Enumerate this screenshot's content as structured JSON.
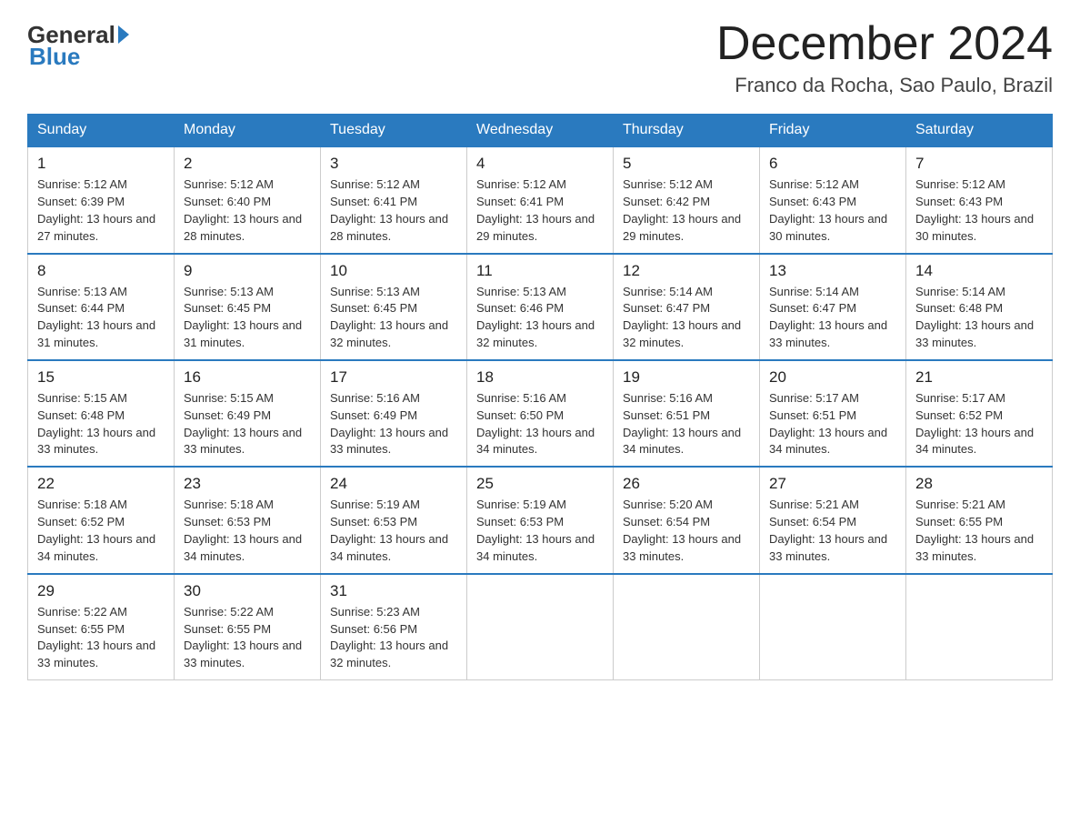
{
  "header": {
    "logo_general": "General",
    "logo_blue": "Blue",
    "title": "December 2024",
    "subtitle": "Franco da Rocha, Sao Paulo, Brazil"
  },
  "days_of_week": [
    "Sunday",
    "Monday",
    "Tuesday",
    "Wednesday",
    "Thursday",
    "Friday",
    "Saturday"
  ],
  "weeks": [
    [
      {
        "day": "1",
        "sunrise": "5:12 AM",
        "sunset": "6:39 PM",
        "daylight": "13 hours and 27 minutes."
      },
      {
        "day": "2",
        "sunrise": "5:12 AM",
        "sunset": "6:40 PM",
        "daylight": "13 hours and 28 minutes."
      },
      {
        "day": "3",
        "sunrise": "5:12 AM",
        "sunset": "6:41 PM",
        "daylight": "13 hours and 28 minutes."
      },
      {
        "day": "4",
        "sunrise": "5:12 AM",
        "sunset": "6:41 PM",
        "daylight": "13 hours and 29 minutes."
      },
      {
        "day": "5",
        "sunrise": "5:12 AM",
        "sunset": "6:42 PM",
        "daylight": "13 hours and 29 minutes."
      },
      {
        "day": "6",
        "sunrise": "5:12 AM",
        "sunset": "6:43 PM",
        "daylight": "13 hours and 30 minutes."
      },
      {
        "day": "7",
        "sunrise": "5:12 AM",
        "sunset": "6:43 PM",
        "daylight": "13 hours and 30 minutes."
      }
    ],
    [
      {
        "day": "8",
        "sunrise": "5:13 AM",
        "sunset": "6:44 PM",
        "daylight": "13 hours and 31 minutes."
      },
      {
        "day": "9",
        "sunrise": "5:13 AM",
        "sunset": "6:45 PM",
        "daylight": "13 hours and 31 minutes."
      },
      {
        "day": "10",
        "sunrise": "5:13 AM",
        "sunset": "6:45 PM",
        "daylight": "13 hours and 32 minutes."
      },
      {
        "day": "11",
        "sunrise": "5:13 AM",
        "sunset": "6:46 PM",
        "daylight": "13 hours and 32 minutes."
      },
      {
        "day": "12",
        "sunrise": "5:14 AM",
        "sunset": "6:47 PM",
        "daylight": "13 hours and 32 minutes."
      },
      {
        "day": "13",
        "sunrise": "5:14 AM",
        "sunset": "6:47 PM",
        "daylight": "13 hours and 33 minutes."
      },
      {
        "day": "14",
        "sunrise": "5:14 AM",
        "sunset": "6:48 PM",
        "daylight": "13 hours and 33 minutes."
      }
    ],
    [
      {
        "day": "15",
        "sunrise": "5:15 AM",
        "sunset": "6:48 PM",
        "daylight": "13 hours and 33 minutes."
      },
      {
        "day": "16",
        "sunrise": "5:15 AM",
        "sunset": "6:49 PM",
        "daylight": "13 hours and 33 minutes."
      },
      {
        "day": "17",
        "sunrise": "5:16 AM",
        "sunset": "6:49 PM",
        "daylight": "13 hours and 33 minutes."
      },
      {
        "day": "18",
        "sunrise": "5:16 AM",
        "sunset": "6:50 PM",
        "daylight": "13 hours and 34 minutes."
      },
      {
        "day": "19",
        "sunrise": "5:16 AM",
        "sunset": "6:51 PM",
        "daylight": "13 hours and 34 minutes."
      },
      {
        "day": "20",
        "sunrise": "5:17 AM",
        "sunset": "6:51 PM",
        "daylight": "13 hours and 34 minutes."
      },
      {
        "day": "21",
        "sunrise": "5:17 AM",
        "sunset": "6:52 PM",
        "daylight": "13 hours and 34 minutes."
      }
    ],
    [
      {
        "day": "22",
        "sunrise": "5:18 AM",
        "sunset": "6:52 PM",
        "daylight": "13 hours and 34 minutes."
      },
      {
        "day": "23",
        "sunrise": "5:18 AM",
        "sunset": "6:53 PM",
        "daylight": "13 hours and 34 minutes."
      },
      {
        "day": "24",
        "sunrise": "5:19 AM",
        "sunset": "6:53 PM",
        "daylight": "13 hours and 34 minutes."
      },
      {
        "day": "25",
        "sunrise": "5:19 AM",
        "sunset": "6:53 PM",
        "daylight": "13 hours and 34 minutes."
      },
      {
        "day": "26",
        "sunrise": "5:20 AM",
        "sunset": "6:54 PM",
        "daylight": "13 hours and 33 minutes."
      },
      {
        "day": "27",
        "sunrise": "5:21 AM",
        "sunset": "6:54 PM",
        "daylight": "13 hours and 33 minutes."
      },
      {
        "day": "28",
        "sunrise": "5:21 AM",
        "sunset": "6:55 PM",
        "daylight": "13 hours and 33 minutes."
      }
    ],
    [
      {
        "day": "29",
        "sunrise": "5:22 AM",
        "sunset": "6:55 PM",
        "daylight": "13 hours and 33 minutes."
      },
      {
        "day": "30",
        "sunrise": "5:22 AM",
        "sunset": "6:55 PM",
        "daylight": "13 hours and 33 minutes."
      },
      {
        "day": "31",
        "sunrise": "5:23 AM",
        "sunset": "6:56 PM",
        "daylight": "13 hours and 32 minutes."
      },
      null,
      null,
      null,
      null
    ]
  ],
  "labels": {
    "sunrise_prefix": "Sunrise: ",
    "sunset_prefix": "Sunset: ",
    "daylight_prefix": "Daylight: "
  },
  "colors": {
    "header_bg": "#2a7abf",
    "border": "#2a7abf",
    "logo_blue": "#2a7abf"
  }
}
